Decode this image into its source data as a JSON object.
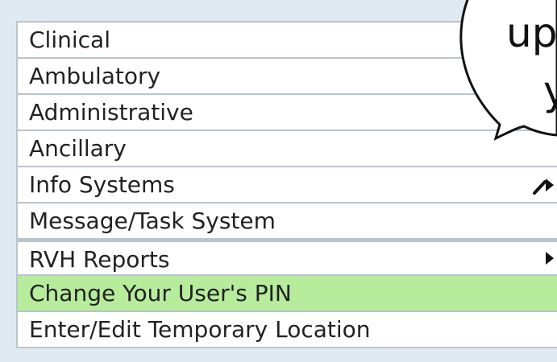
{
  "menu": {
    "items": [
      {
        "label": "Clinical",
        "submenu": false
      },
      {
        "label": "Ambulatory",
        "submenu": false
      },
      {
        "label": "Administrative",
        "submenu": false
      },
      {
        "label": "Ancillary",
        "submenu": false
      },
      {
        "label": "Info Systems",
        "submenu": true
      },
      {
        "label": "Message/Task System",
        "submenu": false
      },
      {
        "label": "RVH Reports",
        "submenu": true
      },
      {
        "label": "Change Your User's PIN",
        "submenu": false,
        "highlighted": true
      },
      {
        "label": "Enter/Edit Temporary Location",
        "submenu": false
      }
    ]
  },
  "callout": {
    "line1": "up",
    "line2": "y"
  },
  "colors": {
    "highlight": "#b7ec9d",
    "background": "#dfe9f0",
    "border": "#b9c4cc"
  }
}
